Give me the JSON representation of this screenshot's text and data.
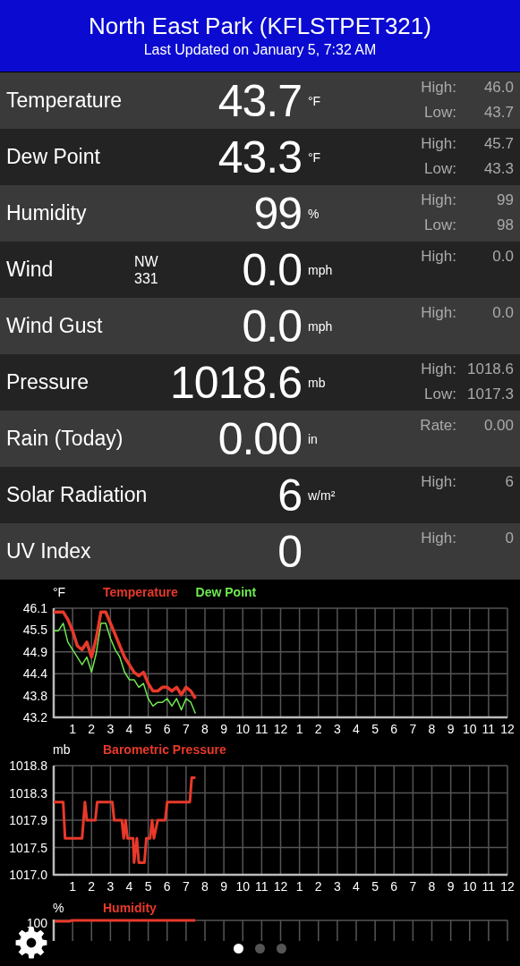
{
  "header": {
    "title": "North East Park (KFLSTPET321)",
    "subtitle": "Last Updated on January 5, 7:32 AM"
  },
  "rows": [
    {
      "name": "Temperature",
      "value": "43.7",
      "unit": "°F",
      "stats": [
        {
          "label": "High:",
          "value": "46.0"
        },
        {
          "label": "Low:",
          "value": "43.7"
        }
      ]
    },
    {
      "name": "Dew Point",
      "value": "43.3",
      "unit": "°F",
      "stats": [
        {
          "label": "High:",
          "value": "45.7"
        },
        {
          "label": "Low:",
          "value": "43.3"
        }
      ]
    },
    {
      "name": "Humidity",
      "value": "99",
      "unit": "%",
      "stats": [
        {
          "label": "High:",
          "value": "99"
        },
        {
          "label": "Low:",
          "value": "98"
        }
      ]
    },
    {
      "name": "Wind",
      "direction": [
        "NW",
        "331"
      ],
      "value": "0.0",
      "unit": "mph",
      "stats": [
        {
          "label": "High:",
          "value": "0.0"
        }
      ]
    },
    {
      "name": "Wind Gust",
      "value": "0.0",
      "unit": "mph",
      "stats": [
        {
          "label": "High:",
          "value": "0.0"
        }
      ]
    },
    {
      "name": "Pressure",
      "value": "1018.6",
      "unit": "mb",
      "stats": [
        {
          "label": "High:",
          "value": "1018.6"
        },
        {
          "label": "Low:",
          "value": "1017.3"
        }
      ]
    },
    {
      "name": "Rain (Today)",
      "value": "0.00",
      "unit": "in",
      "stats": [
        {
          "label": "Rate:",
          "value": "0.00"
        }
      ]
    },
    {
      "name": "Solar Radiation",
      "value": "6",
      "unit": "w/m²",
      "stats": [
        {
          "label": "High:",
          "value": "6"
        }
      ]
    },
    {
      "name": "UV Index",
      "value": "0",
      "stats": [
        {
          "label": "High:",
          "value": "0"
        }
      ]
    }
  ],
  "charts": [
    {
      "afternoon_hour_labels": [
        "1",
        "2",
        "3",
        "4",
        "5",
        "6",
        "7",
        "8",
        "9",
        "10",
        "11",
        "12"
      ],
      "chart_data": {
        "type": "line",
        "grid": true,
        "ylabel": "°F",
        "xlim": [
          0,
          24
        ],
        "xticks": [
          1,
          2,
          3,
          4,
          5,
          6,
          7,
          8,
          9,
          10,
          11,
          12
        ],
        "ylim": [
          43.2,
          46.1
        ],
        "yticks": [
          {
            "value": 43.2,
            "label": "43.2"
          },
          {
            "value": 43.78,
            "label": "43.8"
          },
          {
            "value": 44.36,
            "label": "44.4"
          },
          {
            "value": 44.94,
            "label": "44.9"
          },
          {
            "value": 45.52,
            "label": "45.5"
          },
          {
            "value": 46.1,
            "label": "46.1"
          }
        ],
        "x": [
          0,
          0.25,
          0.5,
          0.75,
          1,
          1.25,
          1.5,
          1.75,
          2,
          2.25,
          2.5,
          2.75,
          3,
          3.25,
          3.5,
          3.75,
          4,
          4.25,
          4.5,
          4.75,
          5,
          5.25,
          5.5,
          5.75,
          6,
          6.25,
          6.5,
          6.75,
          7,
          7.25,
          7.5
        ],
        "series": [
          {
            "name": "Temperature",
            "color": "#e8392a",
            "values": [
              46.0,
              46.0,
              46.0,
              45.8,
              45.5,
              45.1,
              45.0,
              45.2,
              44.8,
              45.3,
              46.0,
              46.0,
              45.7,
              45.4,
              45.1,
              44.8,
              44.6,
              44.4,
              44.3,
              44.4,
              44.1,
              43.9,
              43.9,
              44.0,
              44.0,
              43.9,
              44.0,
              43.8,
              44.0,
              43.9,
              43.7
            ]
          },
          {
            "name": "Dew Point",
            "color": "#6ee84f",
            "values": [
              45.5,
              45.5,
              45.7,
              45.2,
              45.0,
              44.8,
              44.6,
              44.8,
              44.4,
              44.9,
              45.7,
              45.7,
              45.3,
              45.0,
              44.8,
              44.4,
              44.2,
              44.2,
              44.0,
              44.1,
              43.7,
              43.5,
              43.6,
              43.6,
              43.7,
              43.5,
              43.7,
              43.4,
              43.7,
              43.6,
              43.3
            ]
          }
        ]
      }
    },
    {
      "afternoon_hour_labels": [
        "1",
        "2",
        "3",
        "4",
        "5",
        "6",
        "7",
        "8",
        "9",
        "10",
        "11",
        "12"
      ],
      "chart_data": {
        "type": "line",
        "grid": true,
        "ylabel": "mb",
        "xlim": [
          0,
          24
        ],
        "xticks": [
          1,
          2,
          3,
          4,
          5,
          6,
          7,
          8,
          9,
          10,
          11,
          12
        ],
        "ylim": [
          1017.0,
          1018.8
        ],
        "yticks": [
          {
            "value": 1017.0,
            "label": "1017.0"
          },
          {
            "value": 1017.45,
            "label": "1017.5"
          },
          {
            "value": 1017.9,
            "label": "1017.9"
          },
          {
            "value": 1018.35,
            "label": "1018.3"
          },
          {
            "value": 1018.8,
            "label": "1018.8"
          }
        ],
        "x": [
          0,
          0.5,
          0.6,
          1.5,
          1.65,
          1.75,
          2.2,
          2.3,
          3.1,
          3.2,
          3.6,
          3.7,
          3.8,
          3.9,
          4.2,
          4.25,
          4.4,
          4.5,
          4.8,
          4.9,
          5.1,
          5.2,
          5.3,
          5.5,
          5.9,
          6.0,
          7.2,
          7.3,
          7.5
        ],
        "series": [
          {
            "name": "Barometric Pressure",
            "color": "#e8392a",
            "values": [
              1018.2,
              1018.2,
              1017.6,
              1017.6,
              1018.2,
              1017.9,
              1017.9,
              1018.2,
              1018.2,
              1017.9,
              1017.9,
              1017.6,
              1017.9,
              1017.6,
              1017.6,
              1017.2,
              1017.6,
              1017.2,
              1017.2,
              1017.6,
              1017.6,
              1017.9,
              1017.6,
              1017.9,
              1017.9,
              1018.2,
              1018.2,
              1018.6,
              1018.6
            ]
          }
        ]
      }
    }
  ],
  "humidity_chart": {
    "unit": "%",
    "title": "Humidity",
    "ytick": "100"
  },
  "pager": [
    {
      "selected": true
    },
    {
      "selected": false
    },
    {
      "selected": false
    }
  ]
}
